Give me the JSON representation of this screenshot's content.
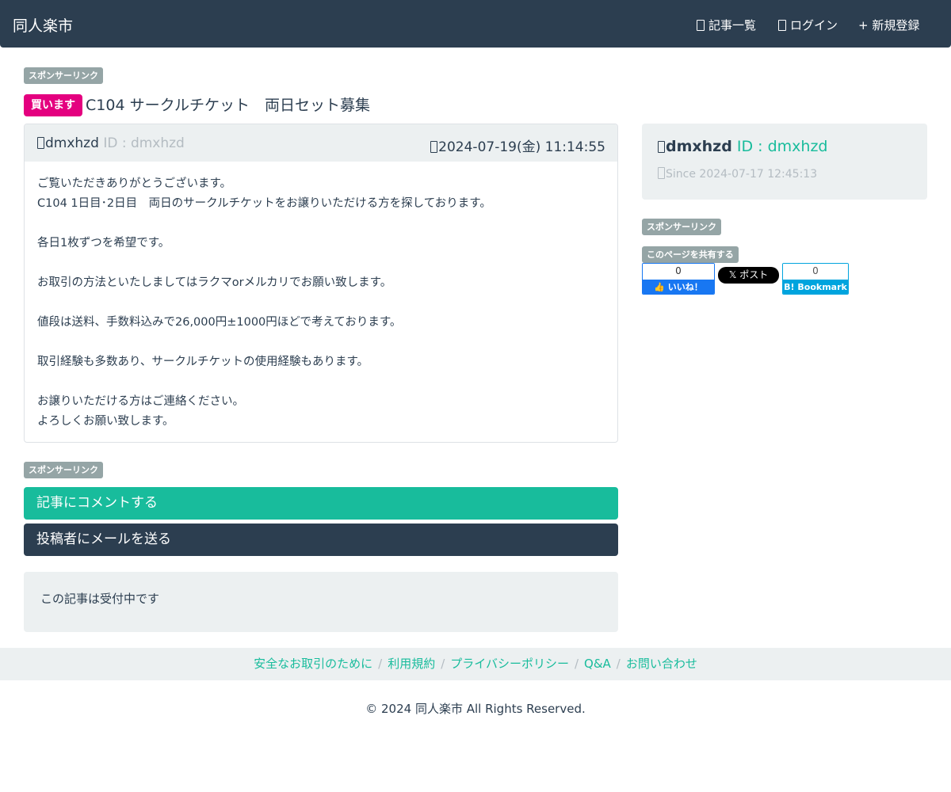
{
  "navbar": {
    "brand": "同人楽市",
    "items": [
      {
        "label": "記事一覧"
      },
      {
        "label": "ログイン"
      },
      {
        "label": "+ 新規登録"
      }
    ]
  },
  "sponsor_label": "スポンサーリンク",
  "post": {
    "type_badge": "買います",
    "title": "C104 サークルチケット　両日セット募集",
    "author_name": "dmxhzd",
    "author_id": "ID : dmxhzd",
    "posted_at": "2024-07-19(金) 11:14:55",
    "body_lines": [
      "ご覧いただきありがとうございます。",
      "C104 1日目･2日目　両日のサークルチケットをお譲りいただける方を探しております。",
      "",
      "各日1枚ずつを希望です。",
      "",
      "お取引の方法といたしましてはラクマorメルカリでお願い致します。",
      "",
      "値段は送料、手数料込みで26,000円±1000円ほどで考えております。",
      "",
      "取引経験も多数あり、サークルチケットの使用経験もあります。",
      "",
      "お譲りいただける方はご連絡ください。",
      "よろしくお願い致します。"
    ]
  },
  "actions": {
    "comment_label": "記事にコメントする",
    "mail_label": "投稿者にメールを送る"
  },
  "status_text": "この記事は受付中です",
  "profile": {
    "name": "dmxhzd",
    "id": "ID : dmxhzd",
    "since": "Since 2024-07-17 12:45:13"
  },
  "share": {
    "label": "このページを共有する",
    "facebook": {
      "count": "0",
      "label": "いいね！"
    },
    "x_label": "ポスト",
    "hatena": {
      "count": "0",
      "label": "Bookmark"
    }
  },
  "footer": {
    "links": [
      "安全なお取引のために",
      "利用規約",
      "プライバシーポリシー",
      "Q&A",
      "お問い合わせ"
    ],
    "copyright": "© 2024 同人楽市 All Rights Reserved."
  },
  "colors": {
    "navbar": "#2c3e50",
    "primary_green": "#18bc9c",
    "buy_badge": "#e4007f",
    "panel_bg": "#ecf0f1",
    "badge_gray": "#95a5a6"
  }
}
